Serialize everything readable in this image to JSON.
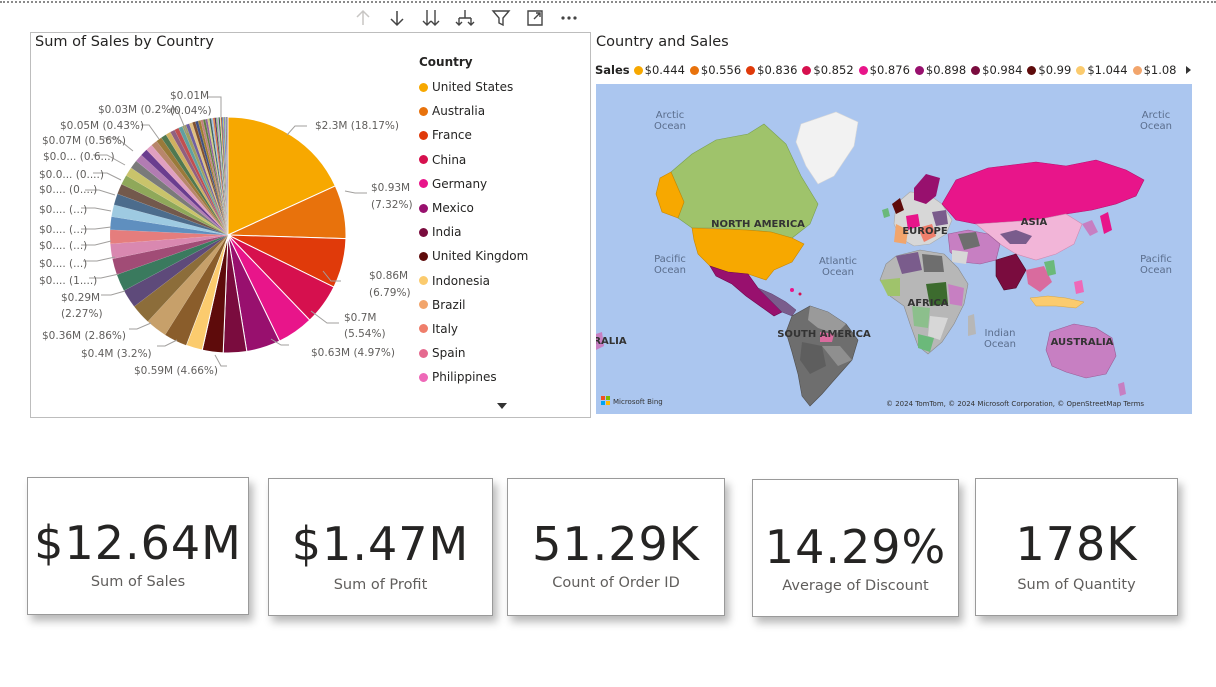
{
  "toolbar": {
    "icons": [
      "arrow-up-icon",
      "arrow-down-icon",
      "double-arrow-down-icon",
      "expand-hierarchy-icon",
      "filter-icon",
      "focus-mode-icon",
      "more-options-icon"
    ]
  },
  "pie": {
    "title": "Sum of Sales by Country",
    "legend_title": "Country",
    "legend": [
      {
        "label": "United States",
        "color": "#F7A800"
      },
      {
        "label": "Australia",
        "color": "#E8720C"
      },
      {
        "label": "France",
        "color": "#E03A0A"
      },
      {
        "label": "China",
        "color": "#D6104E"
      },
      {
        "label": "Germany",
        "color": "#E8158A"
      },
      {
        "label": "Mexico",
        "color": "#98106E"
      },
      {
        "label": "India",
        "color": "#7A0C3E"
      },
      {
        "label": "United Kingdom",
        "color": "#5E0B0B"
      },
      {
        "label": "Indonesia",
        "color": "#FBCB6E"
      },
      {
        "label": "Brazil",
        "color": "#F2A56C"
      },
      {
        "label": "Italy",
        "color": "#EF7E6B"
      },
      {
        "label": "Spain",
        "color": "#E56A8F"
      },
      {
        "label": "Philippines",
        "color": "#EE69B8"
      }
    ],
    "labels": {
      "l0": "$2.3M (18.17%)",
      "l1a": "$0.93M",
      "l1b": "(7.32%)",
      "l2a": "$0.86M",
      "l2b": "(6.79%)",
      "l3a": "$0.7M",
      "l3b": "(5.54%)",
      "l4": "$0.63M (4.97%)",
      "l5": "$0.59M (4.66%)",
      "l6": "$0.4M (3.2%)",
      "l7": "$0.36M (2.86%)",
      "l8a": "$0.29M",
      "l8b": "(2.27%)",
      "s1": "$0.... (1....)",
      "s2": "$0.... (...)",
      "s3": "$0.... (...)",
      "s4": "$0.... (...)",
      "s5": "$0.... (...)",
      "s6": "$0.... (...)",
      "s7": "$0.... (0....)",
      "s8": "$0.0... (0....)",
      "s9": "$0.0... (0.6...)",
      "s10": "$0.07M (0.56%)",
      "s11": "$0.05M (0.43%)",
      "s12": "$0.03M (0.2%)",
      "s13a": "$0.01M",
      "s13b": "(0.04%)"
    }
  },
  "chart_data": {
    "type": "pie",
    "title": "Sum of Sales by Country",
    "legend_title": "Country",
    "legend_position": "right",
    "total_label": "$12.64M",
    "slices": [
      {
        "name": "United States",
        "value": 2.3,
        "percent": 18.17
      },
      {
        "name": "Australia",
        "value": 0.93,
        "percent": 7.32
      },
      {
        "name": "France",
        "value": 0.86,
        "percent": 6.79
      },
      {
        "name": "China",
        "value": 0.7,
        "percent": 5.54
      },
      {
        "name": "Germany",
        "value": 0.63,
        "percent": 4.97
      },
      {
        "name": "Mexico",
        "value": 0.59,
        "percent": 4.66
      },
      {
        "name": "India",
        "value": 0.4,
        "percent": 3.2
      },
      {
        "name": "United Kingdom",
        "value": 0.36,
        "percent": 2.86
      },
      {
        "name": "Indonesia",
        "value": 0.29,
        "percent": 2.27
      }
    ],
    "small_slice_labels": [
      "$0.07M (0.56%)",
      "$0.05M (0.43%)",
      "$0.03M (0.2%)",
      "$0.01M (0.04%)"
    ]
  },
  "map": {
    "title": "Country and Sales",
    "legend_title": "Sales",
    "legend": [
      {
        "label": "$0.444",
        "color": "#F7A800"
      },
      {
        "label": "$0.556",
        "color": "#E8720C"
      },
      {
        "label": "$0.836",
        "color": "#E03A0A"
      },
      {
        "label": "$0.852",
        "color": "#D6104E"
      },
      {
        "label": "$0.876",
        "color": "#E8158A"
      },
      {
        "label": "$0.898",
        "color": "#98106E"
      },
      {
        "label": "$0.984",
        "color": "#7A0C3E"
      },
      {
        "label": "$0.99",
        "color": "#5E0B0B"
      },
      {
        "label": "$1.044",
        "color": "#FBCB6E"
      },
      {
        "label": "$1.08",
        "color": "#F2A56C"
      }
    ],
    "labels": {
      "arctic_l": "Arctic",
      "arctic_l2": "Ocean",
      "arctic_r": "Arctic",
      "arctic_r2": "Ocean",
      "pacific_l": "Pacific",
      "pacific_l2": "Ocean",
      "pacific_r": "Pacific",
      "pacific_r2": "Ocean",
      "atlantic": "Atlantic",
      "atlantic2": "Ocean",
      "indian": "Indian",
      "indian2": "Ocean",
      "north_america": "NORTH AMERICA",
      "south_america": "SOUTH AMERICA",
      "europe": "EUROPE",
      "africa": "AFRICA",
      "asia": "ASIA",
      "australia": "AUSTRALIA",
      "ralia": "RALIA",
      "bing": "Microsoft Bing",
      "copyright": "© 2024 TomTom, © 2024 Microsoft Corporation, © OpenStreetMap  Terms"
    }
  },
  "cards": [
    {
      "value": "$12.64M",
      "label": "Sum of Sales"
    },
    {
      "value": "$1.47M",
      "label": "Sum of Profit"
    },
    {
      "value": "51.29K",
      "label": "Count of Order ID"
    },
    {
      "value": "14.29%",
      "label": "Average of Discount"
    },
    {
      "value": "178K",
      "label": "Sum of Quantity"
    }
  ]
}
